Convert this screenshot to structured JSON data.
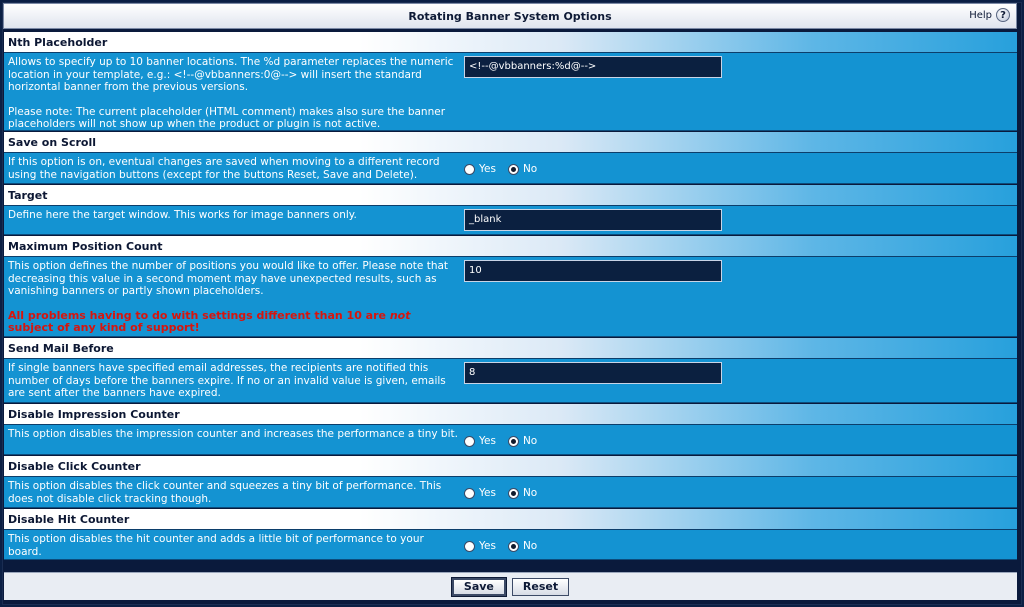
{
  "window": {
    "title": "Rotating Banner System Options",
    "help_label": "Help",
    "help_glyph": "?"
  },
  "sections": [
    {
      "id": "nth",
      "heading": "Nth Placeholder",
      "desc": [
        "Allows to specify up to 10 banner locations. The %d parameter replaces the numeric location in your template, e.g.: <!--@vbbanners:0@--> will insert the standard horizontal banner from the previous versions.",
        "Please note: The current placeholder (HTML comment) makes also sure the banner placeholders will not show up when the product or plugin is not active."
      ],
      "control": "text",
      "value": "<!--@vbbanners:%d@-->"
    },
    {
      "id": "scroll",
      "heading": "Save on Scroll",
      "desc": [
        "If this option is on, eventual changes are saved when moving to a different record using the navigation buttons (except for the buttons Reset, Save and Delete)."
      ],
      "control": "radio",
      "yes_label": "Yes",
      "no_label": "No",
      "selected": "no"
    },
    {
      "id": "target",
      "heading": "Target",
      "desc": [
        "Define here the target window. This works for image banners only."
      ],
      "control": "text",
      "value": "_blank"
    },
    {
      "id": "maxpos",
      "heading": "Maximum Position Count",
      "desc": [
        "This option defines the number of positions you would like to offer. Please note that decreasing this value in a second moment may have unexpected results, such as vanishing banners or partly shown placeholders."
      ],
      "warning_pre": "All problems having to do with settings different than 10 are ",
      "warning_em": "not",
      "warning_post": " subject of any kind of support!",
      "control": "text",
      "value": "10"
    },
    {
      "id": "mail",
      "heading": "Send Mail Before",
      "desc": [
        "If single banners have specified email addresses, the recipients are notified this number of days before the banners expire. If no or an invalid value is given, emails are sent after the banners have expired."
      ],
      "control": "text",
      "value": "8"
    },
    {
      "id": "impr",
      "heading": "Disable Impression Counter",
      "desc": [
        "This option disables the impression counter and increases the performance a tiny bit."
      ],
      "control": "radio",
      "yes_label": "Yes",
      "no_label": "No",
      "selected": "no"
    },
    {
      "id": "click",
      "heading": "Disable Click Counter",
      "desc": [
        "This option disables the click counter and squeezes a tiny bit of performance. This does not disable click tracking though."
      ],
      "control": "radio",
      "yes_label": "Yes",
      "no_label": "No",
      "selected": "no"
    },
    {
      "id": "hit",
      "heading": "Disable Hit Counter",
      "desc": [
        "This option disables the hit counter and adds a little bit of performance to your board."
      ],
      "control": "radio",
      "yes_label": "Yes",
      "no_label": "No",
      "selected": "no"
    }
  ],
  "footer": {
    "save_label": "Save",
    "reset_label": "Reset"
  }
}
